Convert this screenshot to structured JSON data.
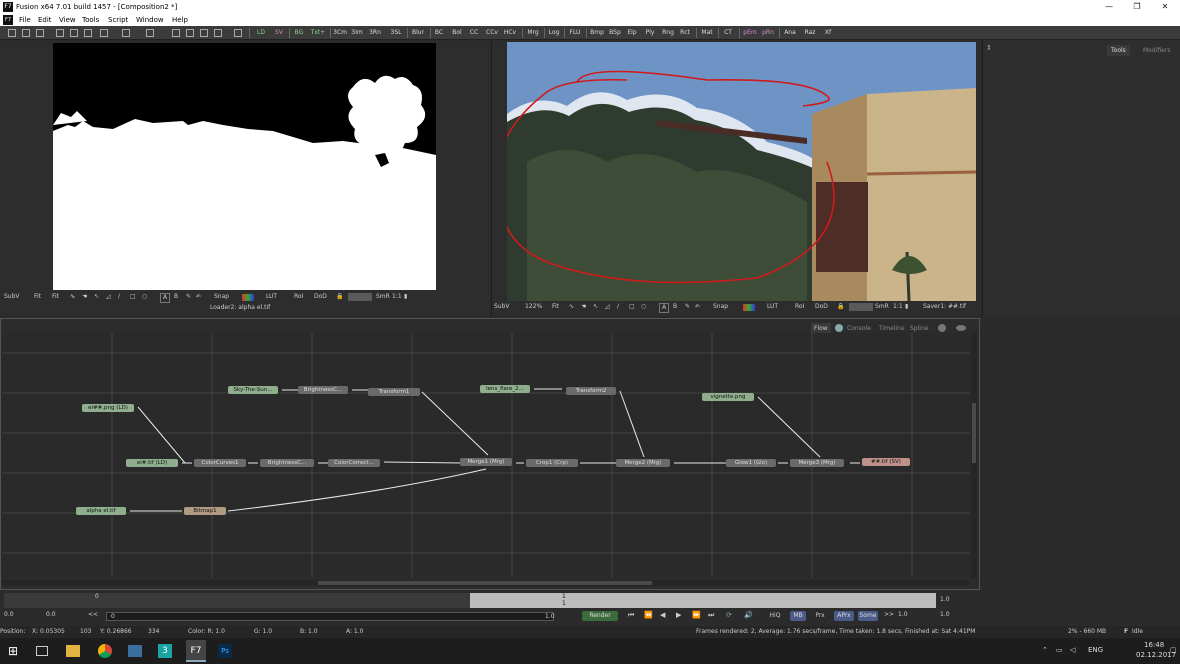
{
  "window": {
    "title": "Fusion x64 7.01 build 1457 - [Composition2 *]",
    "app_icon": "F7"
  },
  "menu": {
    "items": [
      "File",
      "Edit",
      "View",
      "Tools",
      "Script",
      "Window",
      "Help"
    ]
  },
  "toolbar": {
    "buttons": [
      "LD",
      "SV",
      "BG",
      "Txt+",
      "3Cm",
      "3Im",
      "3Rn",
      "3SL",
      "Blur",
      "BC",
      "Bol",
      "CC",
      "CCv",
      "HCv",
      "Mrg",
      "Log",
      "FLU",
      "Bmp",
      "BSp",
      "Elp",
      "Ply",
      "Rng",
      "Rct",
      "Mat",
      "CT",
      "pEm",
      "pRn",
      "Ana",
      "Raz",
      "Xf"
    ]
  },
  "viewer_left": {
    "subv": "SubV",
    "fit1": "Fit",
    "fit2": "Fit",
    "snap": "Snap",
    "lut": "LUT",
    "roi": "RoI",
    "dod": "DoD",
    "smr": "SmR",
    "ratio": "1:1",
    "loader_label": "Loader2: alpha el.tif"
  },
  "viewer_right": {
    "subv": "SubV",
    "zoom": "122%",
    "fit": "Fit",
    "snap": "Snap",
    "lut": "LUT",
    "roi": "RoI",
    "dod": "DoD",
    "smr": "SmR",
    "ratio": "1:1",
    "saver_label": "Saver1: ##.tif"
  },
  "right_panel": {
    "tab_tools": "Tools",
    "tab_modifiers": "Modifiers"
  },
  "flow_tabs": {
    "flow": "Flow",
    "console": "Console",
    "timeline": "Timeline",
    "spline": "Spline"
  },
  "nodes": {
    "sky": "Sky-The-Sun...",
    "bright1": "BrightnessC...",
    "transform1": "Transform1",
    "lens": "lens_flare_2...",
    "transform2": "Transform2",
    "vignette": "vignette.png",
    "elpng": "el##.png (LD)",
    "eltif": "el#.tif (LD)",
    "colorcurves": "ColorCurves1",
    "bright2": "BrightnessC...",
    "colorcorrect": "ColorCorrect...",
    "merge1": "Merge1 (Mrg)",
    "crop1": "Crop1 (Crp)",
    "merge2": "Merge2 (Mrg)",
    "glow1": "Glow1 (Glo)",
    "merge3": "Merge3 (Mrg)",
    "saver": "##.tif (SV)",
    "alpha": "alpha el.tif",
    "bitmap": "Bitmap1"
  },
  "timeline": {
    "start": "0",
    "mid": "1",
    "mid2": "1",
    "right_value": "1.0"
  },
  "transport": {
    "v0": "0.0",
    "v1": "0.0",
    "prev": "<<",
    "v2": "0",
    "v3": "1.0",
    "render": "Render",
    "hiq": "HiQ",
    "mb": "MB",
    "prx": "Prx",
    "aprx": "APrx",
    "some": "Some",
    "next": ">>",
    "v4": "1.0",
    "v5": "1.0"
  },
  "status": {
    "position": "Position:",
    "x": "X: 0.05305",
    "n1": "103",
    "y": "Y: 0.26866",
    "n2": "334",
    "color": "Color: R: 1.0",
    "g": "G: 1.0",
    "b": "B: 1.0",
    "a": "A: 1.0",
    "frames": "Frames rendered: 2,  Average: 1.76 secs/frame,  Time taken: 1.8 secs,  Finished at: Sat 4:41PM",
    "mem": "2% - 660 MB",
    "state": "Idle"
  },
  "taskbar": {
    "lang": "ENG",
    "time": "16:48",
    "date": "02.12.2017"
  },
  "colors": {
    "red_annotation": "#d01a1a",
    "loader_node": "#8fae8d",
    "saver_node": "#c0908a",
    "tool_node": "#6a6a6a",
    "render_btn": "#3b6b3b"
  }
}
